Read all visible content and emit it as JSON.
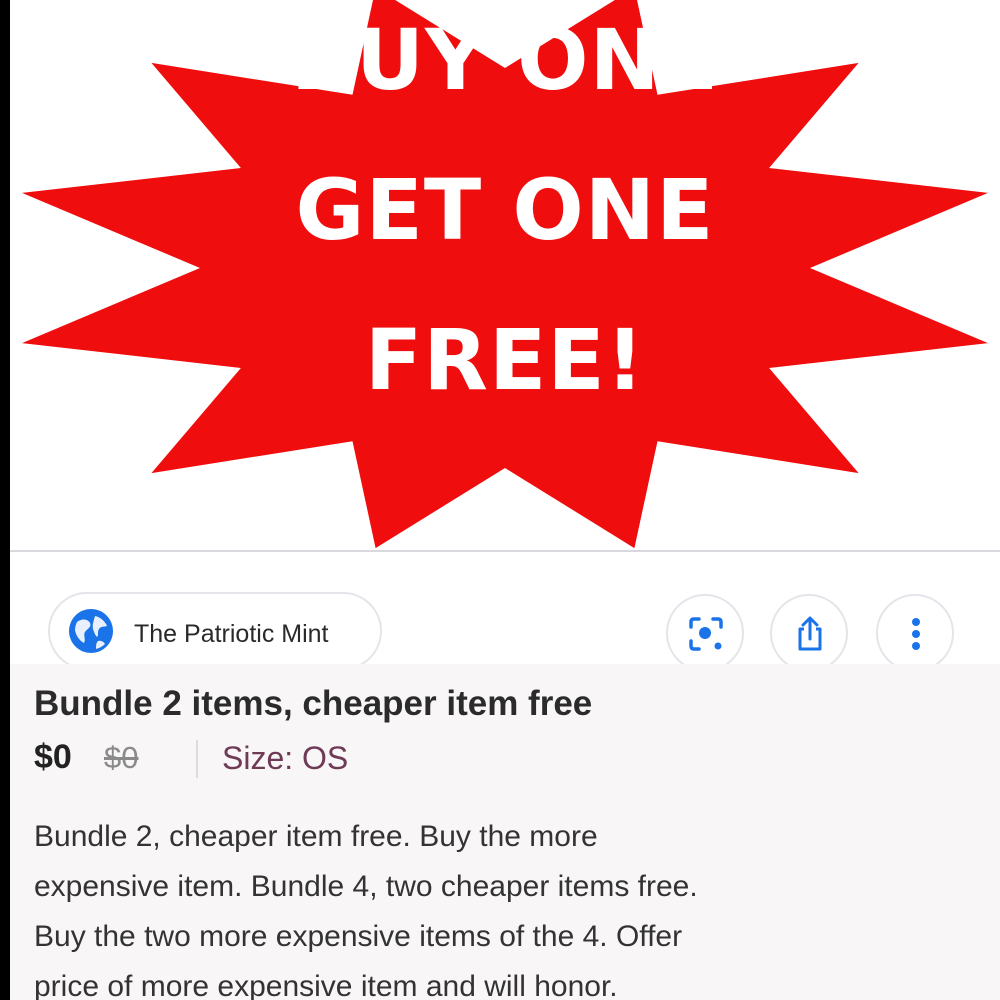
{
  "promo": {
    "line1": "BUY ONE",
    "line2": "GET ONE",
    "line3": "FREE!",
    "burst_color": "#f00d0d",
    "text_color": "#ffffff"
  },
  "seller": {
    "name": "The Patriotic Mint",
    "icon": "globe-icon"
  },
  "actions": {
    "lens_icon": "image-search-icon",
    "share_icon": "share-icon",
    "more_icon": "more-vertical-icon"
  },
  "listing": {
    "title": "Bundle 2 items, cheaper item free",
    "price": "$0",
    "original_price": "$0",
    "size": "Size: OS",
    "description_lines": [
      "Bundle 2, cheaper item free. Buy the more",
      "expensive item. Bundle 4, two cheaper items free.",
      "Buy the two more expensive items of the 4.  Offer",
      "price of more expensive item and will honor."
    ]
  },
  "colors": {
    "accent_red": "#f00d0d",
    "globe_blue": "#1a73e8",
    "size_text": "#6e3a56"
  }
}
